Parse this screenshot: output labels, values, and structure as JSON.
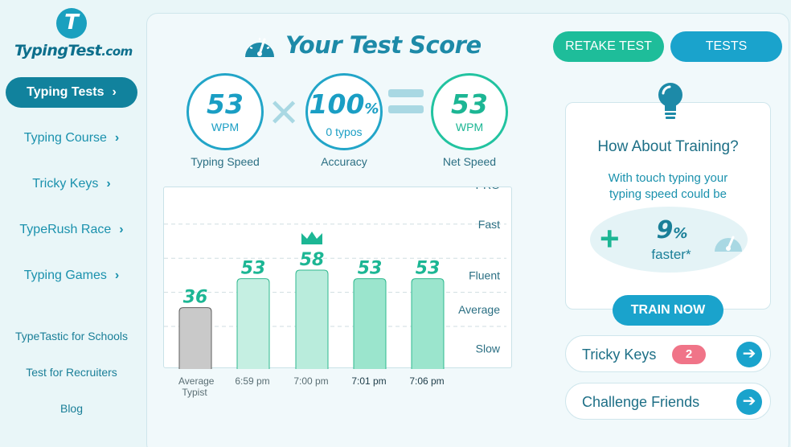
{
  "logo": {
    "mark": "T",
    "name": "TypingTest",
    "tld": ".com"
  },
  "nav": {
    "items": [
      {
        "label": "Typing Tests",
        "active": true
      },
      {
        "label": "Typing Course"
      },
      {
        "label": "Tricky Keys"
      },
      {
        "label": "TypeRush Race"
      },
      {
        "label": "Typing Games"
      }
    ],
    "links": [
      "TypeTastic for Schools",
      "Test for Recruiters",
      "Blog"
    ]
  },
  "header": {
    "title": "Your Test Score",
    "retake_label": "RETAKE TEST",
    "tests_label": "TESTS"
  },
  "score": {
    "speed": {
      "value": "53",
      "unit": "WPM",
      "label": "Typing Speed"
    },
    "accuracy": {
      "value": "100",
      "unit": "%",
      "sub": "0 typos",
      "label": "Accuracy"
    },
    "net": {
      "value": "53",
      "unit": "WPM",
      "label": "Net Speed"
    }
  },
  "chart_data": {
    "type": "bar",
    "categories": [
      "Average Typist",
      "6:59 pm",
      "7:00 pm",
      "7:01 pm",
      "7:06 pm"
    ],
    "values": [
      36,
      53,
      58,
      53,
      53
    ],
    "best_index": 2,
    "ylim": [
      0,
      100
    ],
    "yticks": [
      25,
      45,
      65,
      85
    ],
    "levels": [
      "PRO",
      "Fast",
      "Fluent",
      "Average",
      "Slow"
    ],
    "colors": {
      "average": "#c9c9c9",
      "bar": "#c5efe2",
      "best": "#b9ecdc",
      "recent": "#9be5cd",
      "label": "#1cb694"
    }
  },
  "training": {
    "title": "How About Training?",
    "text_line1": "With touch typing your",
    "text_line2": "typing speed could be",
    "plus": "+",
    "boost_value": "9",
    "boost_unit": "%",
    "boost_label": "faster*",
    "button_label": "TRAIN NOW"
  },
  "links": {
    "tricky_keys": {
      "label": "Tricky Keys",
      "badge": "2"
    },
    "challenge": {
      "label": "Challenge Friends"
    }
  },
  "colors": {
    "accent": "#1aa3cc",
    "green": "#1ebd9a",
    "nav_active": "#11829d",
    "badge": "#f07488"
  }
}
